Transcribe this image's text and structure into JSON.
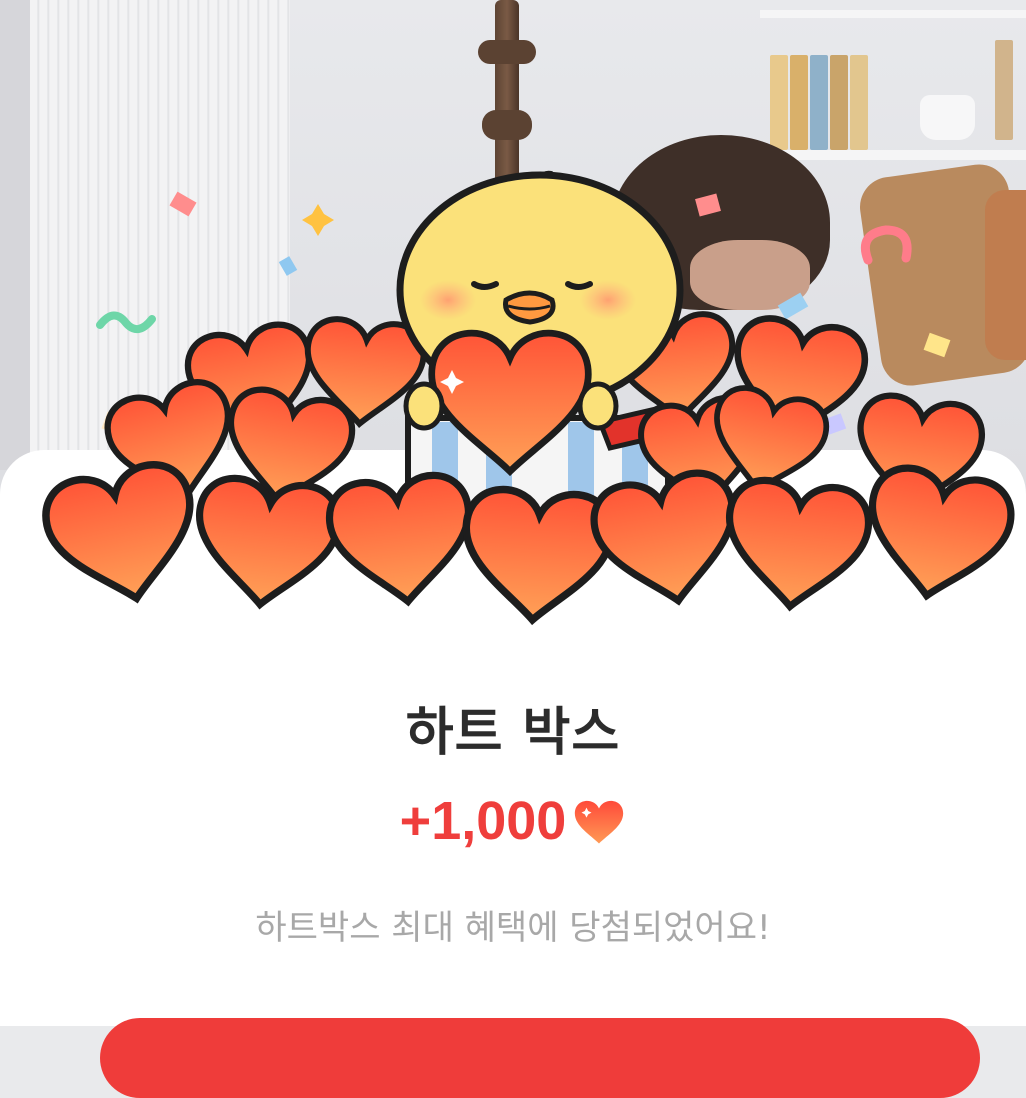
{
  "sheet": {
    "title": "하트 박스",
    "reward_amount": "+1,000",
    "reward_icon": "heart-icon",
    "description": "하트박스 최대 혜택에 당첨되었어요!"
  },
  "colors": {
    "accent": "#ef3e3c",
    "title": "#2c2c2c",
    "description": "#a8a8a8",
    "heart_gradient_top": "#ff5a3c",
    "heart_gradient_bottom": "#ff9a55"
  }
}
